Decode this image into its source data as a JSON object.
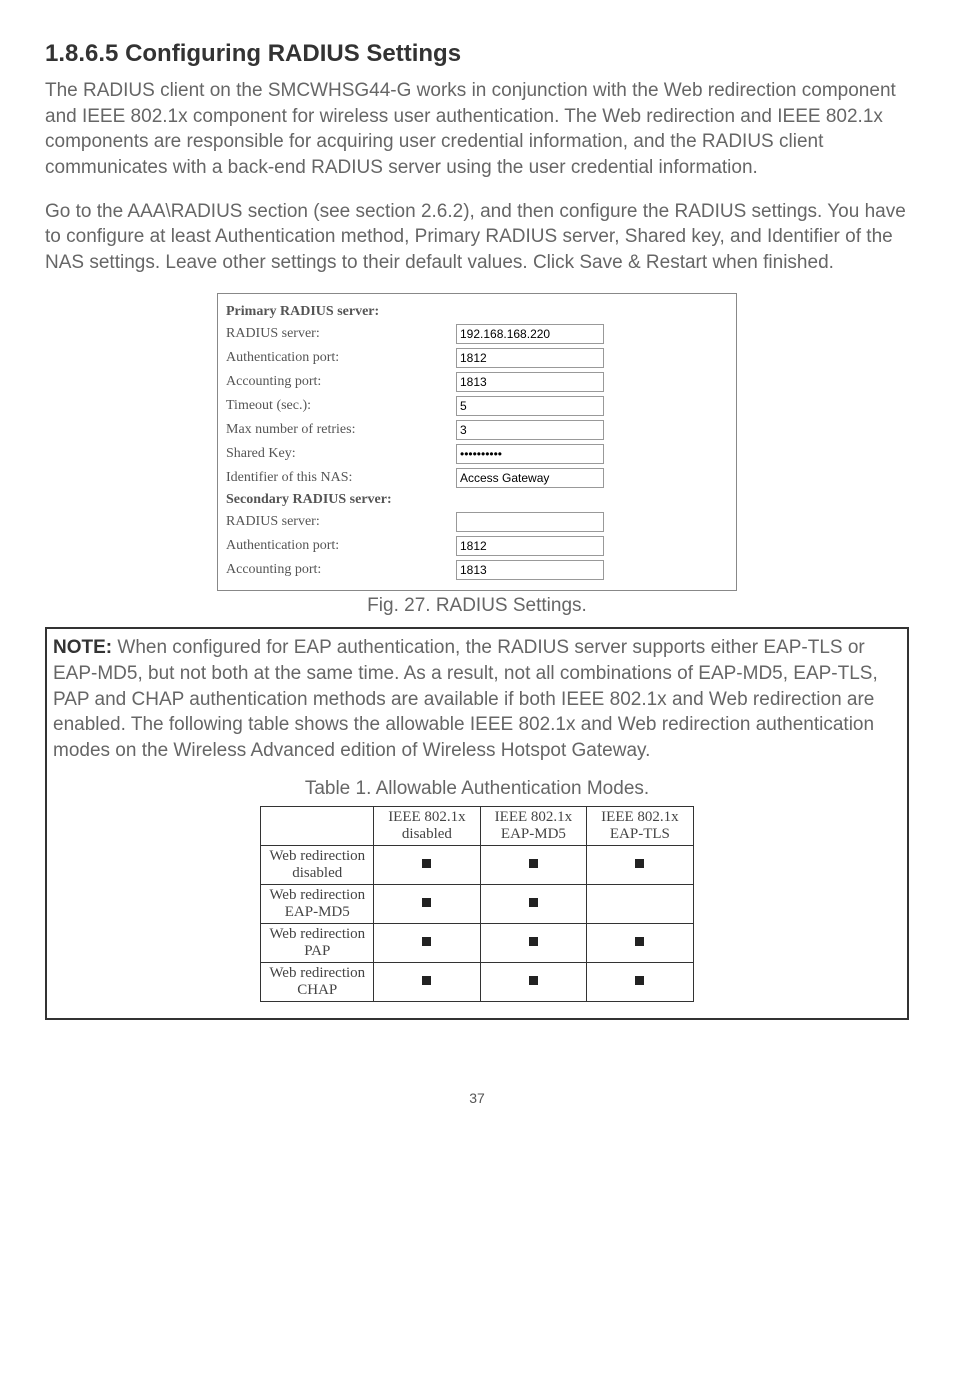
{
  "heading": "1.8.6.5 Configuring RADIUS Settings",
  "para1": "The RADIUS client on the SMCWHSG44-G works in conjunction with the Web redirection component and IEEE 802.1x component for wireless user authentication. The Web redirection and IEEE 802.1x components are responsible for acquiring user credential information, and the RADIUS client communicates with a back-end RADIUS server using the user credential information.",
  "para2": "Go to the AAA\\RADIUS section (see section 2.6.2), and then configure the RADIUS settings. You have to configure at least Authentication method, Primary RADIUS server, Shared key, and Identifier of the NAS settings. Leave other settings to their default values. Click Save & Restart when finished.",
  "config": {
    "primary_heading": "Primary RADIUS server:",
    "secondary_heading": "Secondary RADIUS server:",
    "labels": {
      "server": "RADIUS server:",
      "auth_port": "Authentication port:",
      "acct_port": "Accounting port:",
      "timeout": "Timeout (sec.):",
      "retries": "Max number of retries:",
      "shared_key": "Shared Key:",
      "identifier": "Identifier of this NAS:"
    },
    "primary": {
      "server": "192.168.168.220",
      "auth_port": "1812",
      "acct_port": "1813",
      "timeout": "5",
      "retries": "3",
      "shared_key": "",
      "identifier": "Access Gateway"
    },
    "secondary": {
      "server": "",
      "auth_port": "1812",
      "acct_port": "1813"
    }
  },
  "fig_caption": "Fig. 27. RADIUS Settings.",
  "note_label": "NOTE:",
  "note_text": " When configured for EAP authentication, the RADIUS server supports either EAP-TLS or EAP-MD5, but not both at the same time. As a result, not all combinations of EAP-MD5, EAP-TLS, PAP and CHAP authentication methods are available if both IEEE 802.1x and Web redirection are enabled. The following table shows the allowable IEEE 802.1x and Web redirection authentication modes on the Wireless Advanced edition of Wireless Hotspot Gateway.",
  "table_caption": "Table 1. Allowable Authentication Modes.",
  "table": {
    "cols": [
      {
        "l1": "IEEE 802.1x",
        "l2": "disabled"
      },
      {
        "l1": "IEEE 802.1x",
        "l2": "EAP-MD5"
      },
      {
        "l1": "IEEE 802.1x",
        "l2": "EAP-TLS"
      }
    ],
    "rows": [
      {
        "l1": "Web redirection",
        "l2": "disabled",
        "c": [
          true,
          true,
          true
        ]
      },
      {
        "l1": "Web redirection",
        "l2": "EAP-MD5",
        "c": [
          true,
          true,
          false
        ]
      },
      {
        "l1": "Web redirection",
        "l2": "PAP",
        "c": [
          true,
          true,
          true
        ]
      },
      {
        "l1": "Web redirection",
        "l2": "CHAP",
        "c": [
          true,
          true,
          true
        ]
      }
    ]
  },
  "page_number": "37",
  "chart_data": {
    "type": "table",
    "title": "Table 1. Allowable Authentication Modes.",
    "row_labels": [
      "Web redirection disabled",
      "Web redirection EAP-MD5",
      "Web redirection PAP",
      "Web redirection CHAP"
    ],
    "col_labels": [
      "IEEE 802.1x disabled",
      "IEEE 802.1x EAP-MD5",
      "IEEE 802.1x EAP-TLS"
    ],
    "values": [
      [
        1,
        1,
        1
      ],
      [
        1,
        1,
        0
      ],
      [
        1,
        1,
        1
      ],
      [
        1,
        1,
        1
      ]
    ]
  }
}
